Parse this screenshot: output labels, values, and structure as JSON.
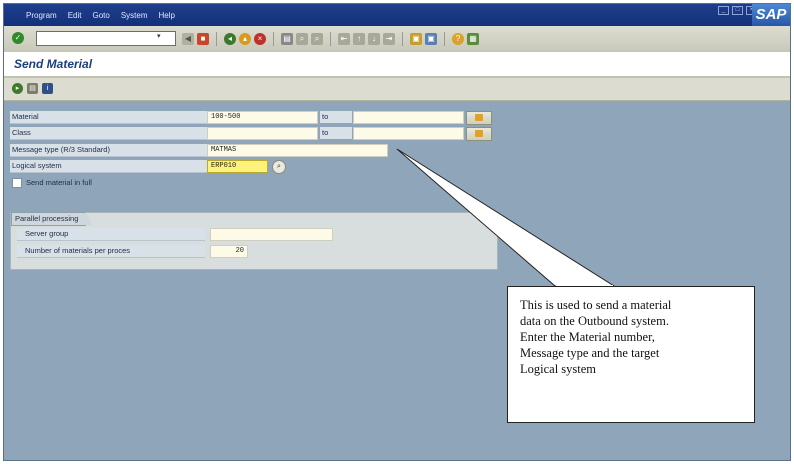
{
  "menu": [
    "Program",
    "Edit",
    "Goto",
    "System",
    "Help"
  ],
  "brand": "SAP",
  "screen_title": "Send Material",
  "fields": {
    "material": {
      "label": "Material",
      "from": "100-500",
      "to_label": "to",
      "to": ""
    },
    "class": {
      "label": "Class",
      "from": "",
      "to_label": "to",
      "to": ""
    },
    "message_type": {
      "label": "Message type (R/3 Standard)",
      "value": "MATMAS"
    },
    "logical_system": {
      "label": "Logical system",
      "value": "ERP010"
    },
    "send_full": {
      "label": "Send material in full",
      "checked": false
    }
  },
  "parallel": {
    "group_label": "Parallel processing",
    "server_group": {
      "label": "Server group",
      "value": ""
    },
    "per_process": {
      "label": "Number of materials per proces",
      "value": "20"
    }
  },
  "callout_lines": [
    "This is used to send a material",
    "data on the Outbound system.",
    "Enter the Material number,",
    "Message type and the target",
    "Logical system"
  ],
  "colors": {
    "menubar": "#1f3f8c",
    "background": "#8fa5ba",
    "input": "#fdfbe8",
    "focused_input": "#fff27a"
  }
}
